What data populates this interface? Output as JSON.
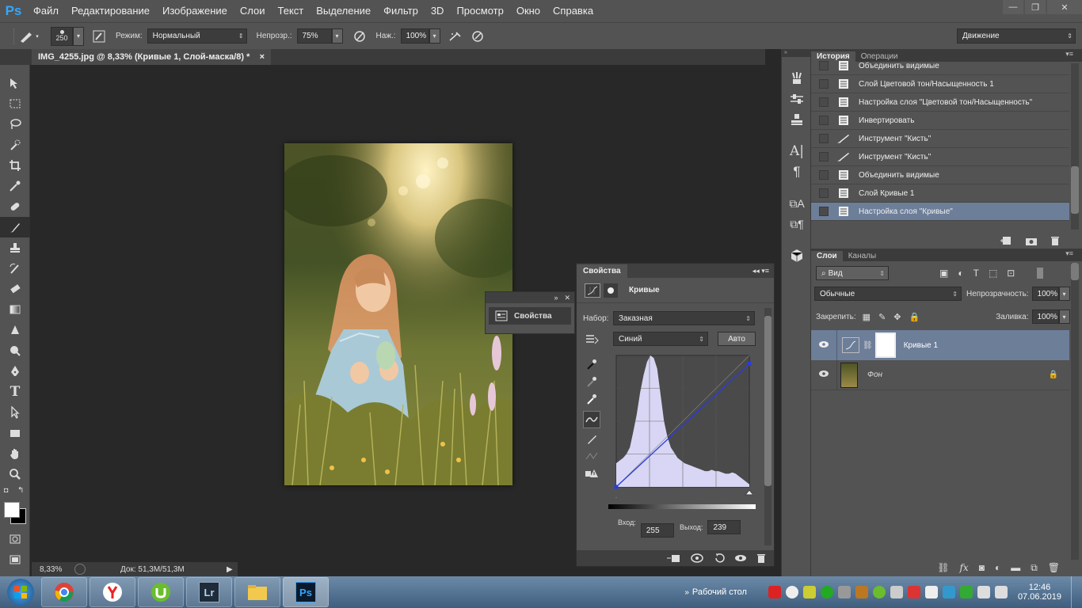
{
  "app": {
    "logo": "Ps"
  },
  "menu": [
    "Файл",
    "Редактирование",
    "Изображение",
    "Слои",
    "Текст",
    "Выделение",
    "Фильтр",
    "3D",
    "Просмотр",
    "Окно",
    "Справка"
  ],
  "window_controls": {
    "minimize": "—",
    "restore": "❐",
    "close": "✕"
  },
  "options": {
    "brush_size": "250",
    "mode_label": "Режим:",
    "mode_value": "Нормальный",
    "opacity_label": "Непрозр.:",
    "opacity_value": "75%",
    "pressure_label": "Наж.:",
    "pressure_value": "100%",
    "workspace": "Движение"
  },
  "document": {
    "tab_title": "IMG_4255.jpg @ 8,33% (Кривые 1, Слой-маска/8) *",
    "close": "×"
  },
  "status": {
    "zoom": "8,33%",
    "doc": "Док: 51,3M/51,3M"
  },
  "float_panel": {
    "label": "Свойства"
  },
  "properties": {
    "tab": "Свойства",
    "title": "Кривые",
    "preset_label": "Набор:",
    "preset_value": "Заказная",
    "channel_value": "Синий",
    "auto_button": "Авто",
    "input_label": "Вход:",
    "input_value": "255",
    "output_label": "Выход:",
    "output_value": "239",
    "histogram_color": "#d8d6f4",
    "curve_color": "#2b3be0"
  },
  "history": {
    "tabs": [
      "История",
      "Операции"
    ],
    "items": [
      {
        "label": "Объединить видимые",
        "icon": "doc-icon"
      },
      {
        "label": "Слой Цветовой тон/Насыщенность 1",
        "icon": "doc-icon"
      },
      {
        "label": "Настройка слоя \"Цветовой тон/Насыщенность\"",
        "icon": "doc-icon"
      },
      {
        "label": "Инвертировать",
        "icon": "doc-icon"
      },
      {
        "label": "Инструмент \"Кисть\"",
        "icon": "brush-icon"
      },
      {
        "label": "Инструмент \"Кисть\"",
        "icon": "brush-icon"
      },
      {
        "label": "Объединить видимые",
        "icon": "doc-icon"
      },
      {
        "label": "Слой Кривые 1",
        "icon": "doc-icon"
      },
      {
        "label": "Настройка слоя \"Кривые\"",
        "icon": "doc-icon",
        "selected": true
      }
    ]
  },
  "layers": {
    "tabs": [
      "Слои",
      "Каналы"
    ],
    "filter_value": "Вид",
    "blend_value": "Обычные",
    "opacity_label": "Непрозрачность:",
    "opacity_value": "100%",
    "lock_label": "Закрепить:",
    "fill_label": "Заливка:",
    "fill_value": "100%",
    "items": [
      {
        "name": "Кривые 1",
        "selected": true
      },
      {
        "name": "Фон",
        "selected": false
      }
    ]
  },
  "taskbar": {
    "show_desktop": "Рабочий стол",
    "time": "12:46",
    "date": "07.06.2019"
  }
}
